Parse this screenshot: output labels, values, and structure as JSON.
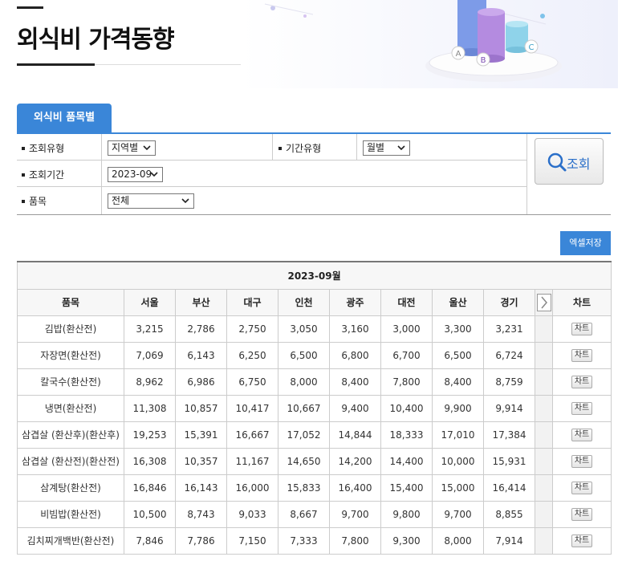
{
  "page": {
    "title": "외식비 가격동향"
  },
  "tab": {
    "label": "외식비 품목별"
  },
  "filters": {
    "query_type_label": "조회유형",
    "query_type_value": "지역별",
    "period_type_label": "기간유형",
    "period_type_value": "월별",
    "period_label": "조회기간",
    "period_value": "2023-09",
    "item_label": "품목",
    "item_value": "전체",
    "search_label": "조회"
  },
  "excel_button": "엑셀저장",
  "table": {
    "period": "2023-09월",
    "headers": [
      "품목",
      "서울",
      "부산",
      "대구",
      "인천",
      "광주",
      "대전",
      "울산",
      "경기",
      "차트"
    ],
    "chart_button": "차트",
    "rows": [
      {
        "item": "김밥(환산전)",
        "values": [
          "3,215",
          "2,786",
          "2,750",
          "3,050",
          "3,160",
          "3,000",
          "3,300",
          "3,231"
        ]
      },
      {
        "item": "자장면(환산전)",
        "values": [
          "7,069",
          "6,143",
          "6,250",
          "6,500",
          "6,800",
          "6,700",
          "6,500",
          "6,724"
        ]
      },
      {
        "item": "칼국수(환산전)",
        "values": [
          "8,962",
          "6,986",
          "6,750",
          "8,000",
          "8,400",
          "7,800",
          "8,400",
          "8,759"
        ]
      },
      {
        "item": "냉면(환산전)",
        "values": [
          "11,308",
          "10,857",
          "10,417",
          "10,667",
          "9,400",
          "10,400",
          "9,900",
          "9,914"
        ]
      },
      {
        "item": "삼겹살 (환산후)(환산후)",
        "values": [
          "19,253",
          "15,391",
          "16,667",
          "17,052",
          "14,844",
          "18,333",
          "17,010",
          "17,384"
        ]
      },
      {
        "item": "삼겹살 (환산전)(환산전)",
        "values": [
          "16,308",
          "10,357",
          "11,167",
          "14,650",
          "14,200",
          "14,400",
          "10,000",
          "15,931"
        ]
      },
      {
        "item": "삼계탕(환산전)",
        "values": [
          "16,846",
          "16,143",
          "16,000",
          "15,833",
          "16,400",
          "15,400",
          "15,000",
          "16,414"
        ]
      },
      {
        "item": "비빔밥(환산전)",
        "values": [
          "10,500",
          "8,743",
          "9,033",
          "8,667",
          "9,700",
          "9,800",
          "9,700",
          "8,855"
        ]
      },
      {
        "item": "김치찌개백반(환산전)",
        "values": [
          "7,846",
          "7,786",
          "7,150",
          "7,333",
          "7,800",
          "9,300",
          "8,000",
          "7,914"
        ]
      }
    ]
  },
  "decoration": {
    "cylinder_labels": [
      "A",
      "B",
      "C"
    ]
  }
}
